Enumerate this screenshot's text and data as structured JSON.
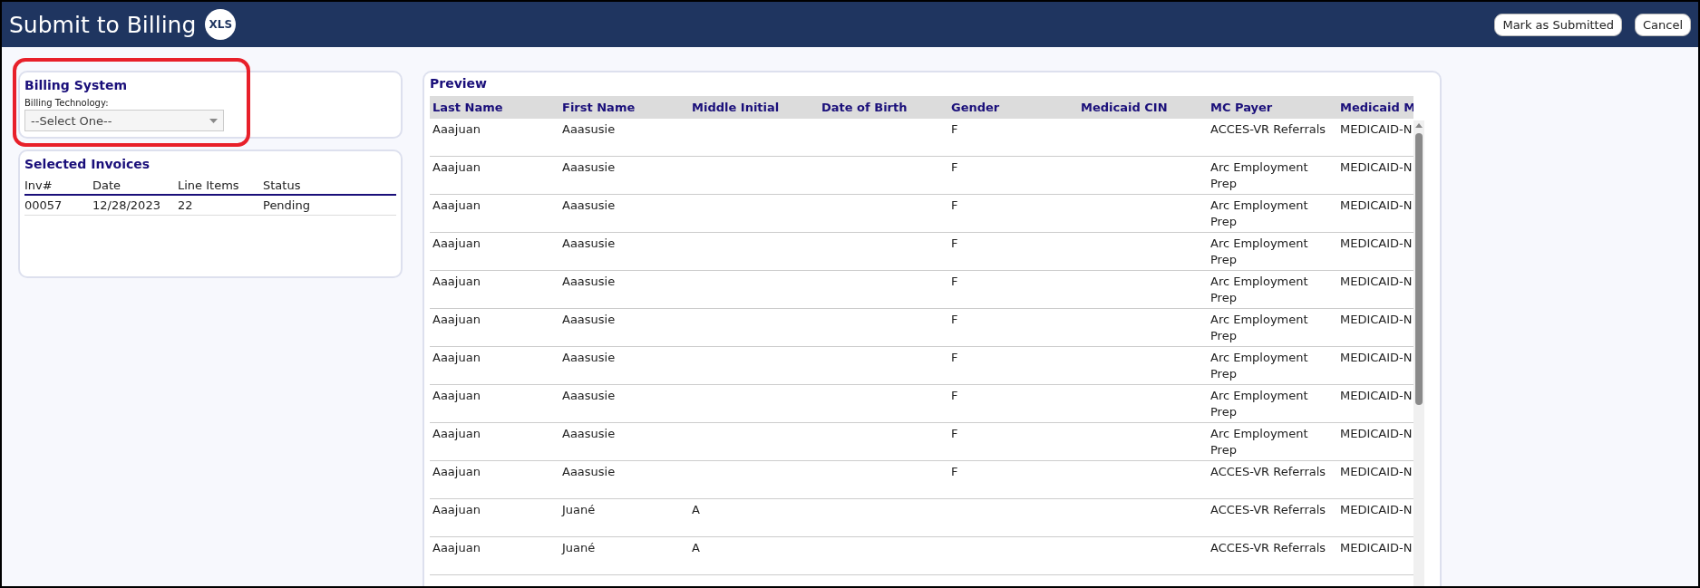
{
  "header": {
    "title": "Submit to Billing",
    "badge": "XLS",
    "buttons": [
      {
        "label": "Mark as Submitted"
      },
      {
        "label": "Cancel"
      }
    ]
  },
  "billing_system": {
    "title": "Billing System",
    "field_label": "Billing Technology:",
    "select_value": "--Select One--"
  },
  "selected_invoices": {
    "title": "Selected Invoices",
    "columns": [
      "Inv#",
      "Date",
      "Line Items",
      "Status"
    ],
    "rows": [
      [
        "00057",
        "12/28/2023",
        "22",
        "Pending"
      ]
    ]
  },
  "preview": {
    "title": "Preview",
    "columns": [
      "Last Name",
      "First Name",
      "Middle Initial",
      "Date of Birth",
      "Gender",
      "Medicaid CIN",
      "MC Payer",
      "Medicaid M"
    ],
    "rows": [
      {
        "last_name": "Aaajuan",
        "first_name": "Aaasusie",
        "gender": "F",
        "mc_payer": "ACCES-VR Referrals",
        "column_8": "MEDICAID-N"
      },
      {
        "last_name": "Aaajuan",
        "first_name": "Aaasusie",
        "gender": "F",
        "mc_payer": "Arc Employment Prep",
        "column_8": "MEDICAID-N"
      },
      {
        "last_name": "Aaajuan",
        "first_name": "Aaasusie",
        "gender": "F",
        "mc_payer": "Arc Employment Prep",
        "column_8": "MEDICAID-N"
      },
      {
        "last_name": "Aaajuan",
        "first_name": "Aaasusie",
        "gender": "F",
        "mc_payer": "Arc Employment Prep",
        "column_8": "MEDICAID-N"
      },
      {
        "last_name": "Aaajuan",
        "first_name": "Aaasusie",
        "gender": "F",
        "mc_payer": "Arc Employment Prep",
        "column_8": "MEDICAID-N"
      },
      {
        "last_name": "Aaajuan",
        "first_name": "Aaasusie",
        "gender": "F",
        "mc_payer": "Arc Employment Prep",
        "column_8": "MEDICAID-N"
      },
      {
        "last_name": "Aaajuan",
        "first_name": "Aaasusie",
        "gender": "F",
        "mc_payer": "Arc Employment Prep",
        "column_8": "MEDICAID-N"
      },
      {
        "last_name": "Aaajuan",
        "first_name": "Aaasusie",
        "gender": "F",
        "mc_payer": "Arc Employment Prep",
        "column_8": "MEDICAID-N"
      },
      {
        "last_name": "Aaajuan",
        "first_name": "Aaasusie",
        "gender": "F",
        "mc_payer": "Arc Employment Prep",
        "column_8": "MEDICAID-N"
      },
      {
        "last_name": "Aaajuan",
        "first_name": "Aaasusie",
        "gender": "F",
        "mc_payer": "ACCES-VR Referrals",
        "column_8": "MEDICAID-N"
      },
      {
        "last_name": "Aaajuan",
        "first_name": "Juané",
        "middle_initial": "A",
        "mc_payer": "ACCES-VR Referrals",
        "column_8": "MEDICAID-N"
      },
      {
        "last_name": "Aaajuan",
        "first_name": "Juané",
        "middle_initial": "A",
        "mc_payer": "ACCES-VR Referrals",
        "column_8": "MEDICAID-N"
      }
    ]
  }
}
